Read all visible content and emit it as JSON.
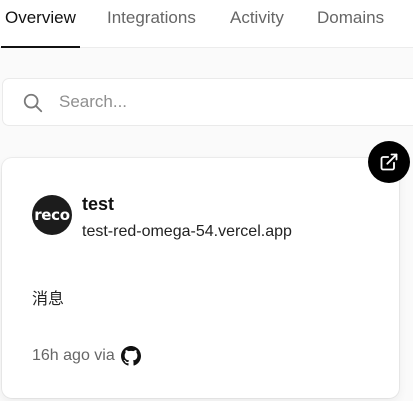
{
  "tabs": [
    {
      "label": "Overview",
      "active": true
    },
    {
      "label": "Integrations",
      "active": false
    },
    {
      "label": "Activity",
      "active": false
    },
    {
      "label": "Domains",
      "active": false
    }
  ],
  "search": {
    "placeholder": "Search...",
    "value": "",
    "icon": "search-icon"
  },
  "project": {
    "avatar_text": "reco",
    "name": "test",
    "url": "test-red-omega-54.vercel.app",
    "message": "消息",
    "time": "16h ago via",
    "source_icon": "github-icon",
    "open_icon": "external-link-icon"
  },
  "colors": {
    "background": "#fafafa",
    "text": "#111111",
    "muted": "#666666",
    "avatar_bg": "#1c1c1c",
    "open_button_bg": "#000000"
  }
}
